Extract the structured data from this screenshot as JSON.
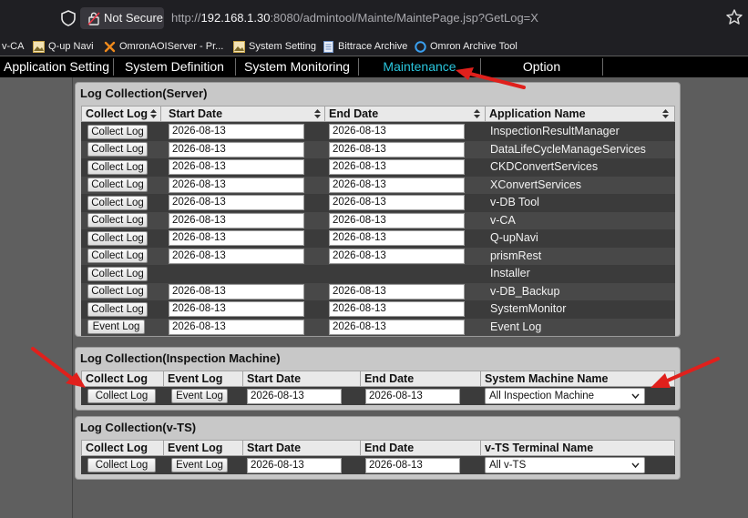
{
  "browser": {
    "security_label": "Not Secure",
    "url_prefix": "http://",
    "url_host": "192.168.1.30",
    "url_rest": ":8080/admintool/Mainte/MaintePage.jsp?GetLog=X"
  },
  "bookmarks": [
    {
      "label": "v-CA",
      "icon": "none"
    },
    {
      "label": "Q-up Navi",
      "icon": "image-icon"
    },
    {
      "label": "OmronAOIServer - Pr...",
      "icon": "tools-x-icon"
    },
    {
      "label": "System Setting",
      "icon": "image-icon"
    },
    {
      "label": "Bittrace Archive",
      "icon": "document-icon"
    },
    {
      "label": "Omron Archive Tool",
      "icon": "globe-icon"
    }
  ],
  "nav": {
    "items": [
      "Application Setting",
      "System Definition",
      "System Monitoring",
      "Maintenance",
      "Option"
    ],
    "active": "Maintenance",
    "active_color": "#2ac5dc"
  },
  "server": {
    "title": "Log Collection(Server)",
    "headers": [
      "Collect Log",
      "Start Date",
      "End Date",
      "Application Name"
    ],
    "rows": [
      {
        "button": "Collect Log",
        "start": "2026-08-13",
        "end": "2026-08-13",
        "app": "InspectionResultManager"
      },
      {
        "button": "Collect Log",
        "start": "2026-08-13",
        "end": "2026-08-13",
        "app": "DataLifeCycleManageServices"
      },
      {
        "button": "Collect Log",
        "start": "2026-08-13",
        "end": "2026-08-13",
        "app": "CKDConvertServices"
      },
      {
        "button": "Collect Log",
        "start": "2026-08-13",
        "end": "2026-08-13",
        "app": "XConvertServices"
      },
      {
        "button": "Collect Log",
        "start": "2026-08-13",
        "end": "2026-08-13",
        "app": "v-DB Tool"
      },
      {
        "button": "Collect Log",
        "start": "2026-08-13",
        "end": "2026-08-13",
        "app": "v-CA"
      },
      {
        "button": "Collect Log",
        "start": "2026-08-13",
        "end": "2026-08-13",
        "app": "Q-upNavi"
      },
      {
        "button": "Collect Log",
        "start": "2026-08-13",
        "end": "2026-08-13",
        "app": "prismRest"
      },
      {
        "button": "Collect Log",
        "start": "",
        "end": "",
        "app": "Installer"
      },
      {
        "button": "Collect Log",
        "start": "2026-08-13",
        "end": "2026-08-13",
        "app": "v-DB_Backup"
      },
      {
        "button": "Collect Log",
        "start": "2026-08-13",
        "end": "2026-08-13",
        "app": "SystemMonitor"
      },
      {
        "button": "Event Log",
        "start": "2026-08-13",
        "end": "2026-08-13",
        "app": "Event Log"
      }
    ]
  },
  "inspection": {
    "title": "Log Collection(Inspection Machine)",
    "headers": [
      "Collect Log",
      "Event Log",
      "Start Date",
      "End Date",
      "System Machine Name"
    ],
    "collect_button": "Collect Log",
    "event_button": "Event Log",
    "start": "2026-08-13",
    "end": "2026-08-13",
    "machine_selected": "All Inspection Machine"
  },
  "vts": {
    "title": "Log Collection(v-TS)",
    "headers": [
      "Collect Log",
      "Event Log",
      "Start Date",
      "End Date",
      "v-TS Terminal Name"
    ],
    "collect_button": "Collect Log",
    "event_button": "Event Log",
    "start": "2026-08-13",
    "end": "2026-08-13",
    "terminal_selected": "All v-TS"
  },
  "annotation_color": "#e0201c"
}
